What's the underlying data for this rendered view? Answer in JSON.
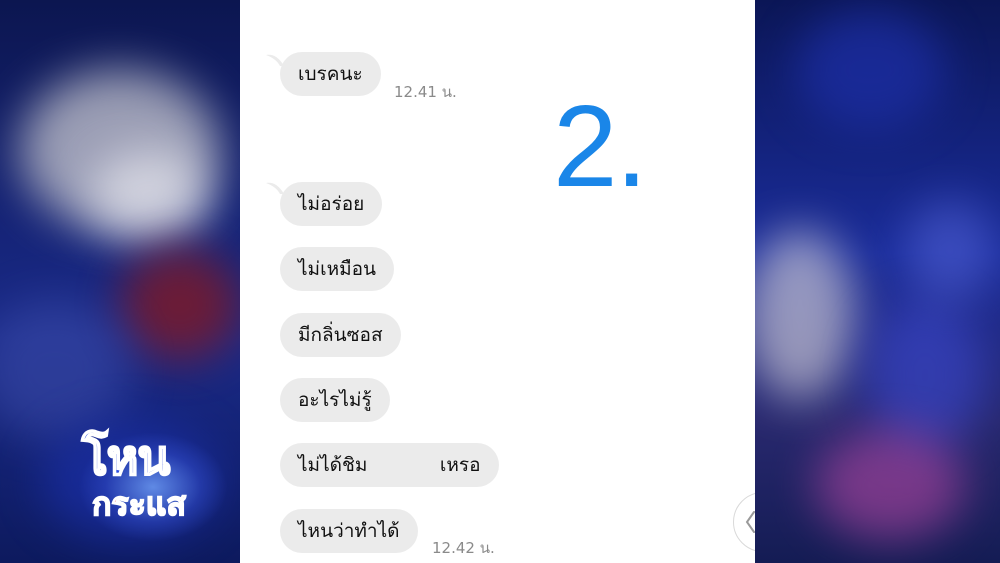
{
  "chat": {
    "messages": [
      {
        "text": "เบรคนะ",
        "time": "12.41 น."
      },
      {
        "text": "ไม่อร่อย"
      },
      {
        "text": "ไม่เหมือน"
      },
      {
        "text": "มีกลิ่นซอส"
      },
      {
        "text": "อะไรไม่รู้"
      },
      {
        "text": "ไม่ได้ชิม            เหรอ"
      },
      {
        "text": "ไหนว่าทำได้",
        "time": "12.42 น."
      }
    ]
  },
  "overlay": {
    "number_label": "2."
  },
  "logo": {
    "line1": "โหน",
    "line2": "กระแส"
  },
  "colors": {
    "bubble": "#ebebeb",
    "accent_number": "#1a86e8",
    "logo_blue": "#2d4fe0",
    "logo_red": "#e8201c"
  },
  "icons": {
    "scroll": "chevron-down-icon"
  }
}
